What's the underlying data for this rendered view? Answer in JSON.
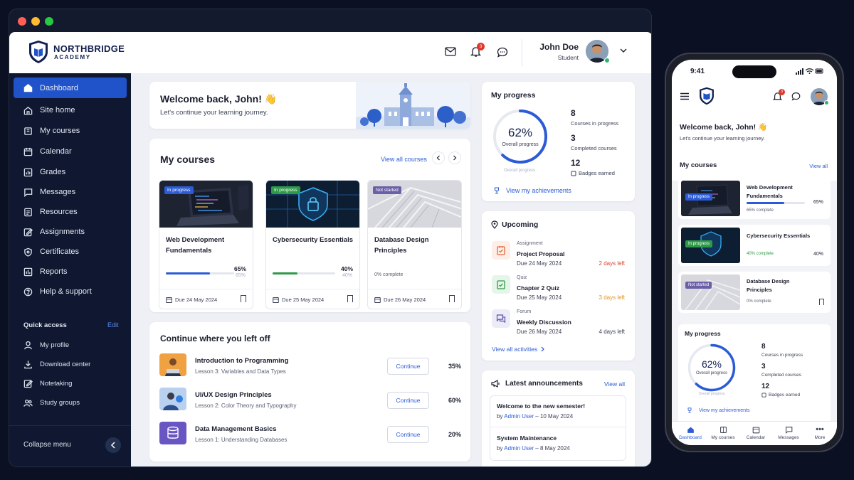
{
  "brand": {
    "name": "NORTHBRIDGE",
    "sub": "ACADEMY"
  },
  "header": {
    "notif_count": "3",
    "user_name": "John Doe",
    "user_role": "Student"
  },
  "sidebar": {
    "items": [
      {
        "label": "Dashboard",
        "icon": "home-icon"
      },
      {
        "label": "Site home",
        "icon": "house-icon"
      },
      {
        "label": "My courses",
        "icon": "book-icon"
      },
      {
        "label": "Calendar",
        "icon": "calendar-icon"
      },
      {
        "label": "Grades",
        "icon": "chart-icon"
      },
      {
        "label": "Messages",
        "icon": "message-icon"
      },
      {
        "label": "Resources",
        "icon": "folder-icon"
      },
      {
        "label": "Assignments",
        "icon": "edit-icon"
      },
      {
        "label": "Certificates",
        "icon": "shield-icon"
      },
      {
        "label": "Reports",
        "icon": "report-icon"
      },
      {
        "label": "Help & support",
        "icon": "help-icon"
      }
    ],
    "quick_title": "Quick access",
    "quick_edit": "Edit",
    "quick": [
      {
        "label": "My profile"
      },
      {
        "label": "Download center"
      },
      {
        "label": "Notetaking"
      },
      {
        "label": "Study groups"
      }
    ],
    "collapse": "Collapse menu"
  },
  "welcome": {
    "title": "Welcome back, John! 👋",
    "sub": "Let's continue your learning journey."
  },
  "courses": {
    "title": "My courses",
    "view_all": "View all courses",
    "items": [
      {
        "badge": "In progress",
        "name": "Web Development Fundamentals",
        "pct": "65%",
        "progress": 0.65,
        "progress_label": "65%",
        "due": "Due 24 May 2024",
        "badge_color": "#2b5bd6",
        "bar_color": "#2b5bd6"
      },
      {
        "badge": "In progress",
        "name": "Cybersecurity Essentials",
        "pct": "40%",
        "progress": 0.4,
        "progress_label": "40%",
        "due": "Due 25 May 2024",
        "badge_color": "#2e9a47",
        "bar_color": "#2e9a47"
      },
      {
        "badge": "Not started",
        "name": "Database Design Principles",
        "pct": "0% complete",
        "progress": 0,
        "progress_label": "",
        "due": "Due 26 May 2024",
        "badge_color": "#6b5fa8",
        "bar_color": "#2b5bd6"
      }
    ]
  },
  "continue": {
    "title": "Continue where you left off",
    "button": "Continue",
    "items": [
      {
        "name": "Introduction to Programming",
        "lesson": "Lesson 3: Variables and Data Types",
        "pct": "35%"
      },
      {
        "name": "UI/UX Design Principles",
        "lesson": "Lesson 2: Color Theory and Typography",
        "pct": "60%"
      },
      {
        "name": "Data Management Basics",
        "lesson": "Lesson 1: Understanding Databases",
        "pct": "20%"
      }
    ]
  },
  "progress": {
    "title": "My progress",
    "pct": "62%",
    "value": 0.62,
    "overall": "Overall progress",
    "caption": "Overall progress",
    "stats": [
      {
        "n": "8",
        "l": "Courses in progress"
      },
      {
        "n": "3",
        "l": "Completed courses"
      },
      {
        "n": "12",
        "l": "Badges earned"
      }
    ],
    "achievements": "View my achievements"
  },
  "upcoming": {
    "title": "Upcoming",
    "view_all": "View all activities",
    "items": [
      {
        "kind": "Assignment",
        "name": "Project Proposal",
        "date": "Due 24 May 2024",
        "left": "2 days left",
        "left_color": "#d9482b"
      },
      {
        "kind": "Quiz",
        "name": "Chapter 2 Quiz",
        "date": "Due 25 May 2024",
        "left": "3 days left",
        "left_color": "#e0931f"
      },
      {
        "kind": "Forum",
        "name": "Weekly Discussion",
        "date": "Due 26 May 2024",
        "left": "4 days left",
        "left_color": "#3c4257"
      }
    ]
  },
  "announcements": {
    "title": "Latest announcements",
    "view_all": "View all",
    "by": "by",
    "items": [
      {
        "title": "Welcome to the new semester!",
        "author": "Admin User",
        "date": "– 10 May 2024"
      },
      {
        "title": "System Maintenance",
        "author": "Admin User",
        "date": "– 8 May 2024"
      }
    ]
  },
  "phone": {
    "time": "9:41",
    "notif": "3",
    "welcome": "Welcome back, John! 👋",
    "sub": "Let's continue your learning journey.",
    "courses_title": "My courses",
    "view_all": "View all",
    "courses": [
      {
        "badge": "In progress",
        "name": "Web Development Fundamentals",
        "complete": "65% complete",
        "pct": "65%",
        "progress": 0.65
      },
      {
        "badge": "In progress",
        "name": "Cybersecurity Essentials",
        "complete": "40% complete",
        "pct": "40%",
        "progress": 0.4
      },
      {
        "badge": "Not started",
        "name": "Database Design Principles",
        "complete": "0% complete",
        "pct": "",
        "progress": 0
      }
    ],
    "progress_title": "My progress",
    "pct": "62%",
    "overall": "Overall progress",
    "caption": "Overall progress",
    "stats": [
      {
        "n": "8",
        "l": "Courses in progress"
      },
      {
        "n": "3",
        "l": "Completed courses"
      },
      {
        "n": "12",
        "l": "Badges earned"
      }
    ],
    "achievements": "View my achievements",
    "tabs": [
      {
        "label": "Dashboard"
      },
      {
        "label": "My courses"
      },
      {
        "label": "Calendar"
      },
      {
        "label": "Messages"
      },
      {
        "label": "More"
      }
    ]
  },
  "colors": {
    "accent": "#2053c9",
    "sidebar": "#0f1830",
    "page": "#eef0f5"
  }
}
